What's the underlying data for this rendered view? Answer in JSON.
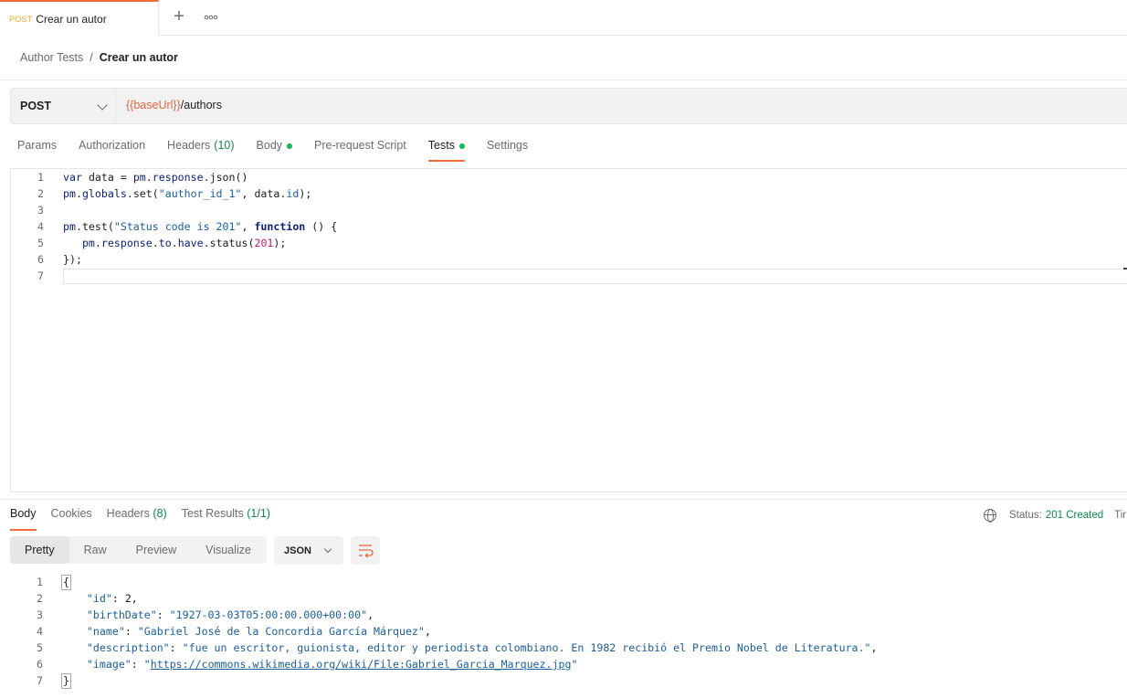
{
  "tab": {
    "method": "POST",
    "name": "Crear un autor"
  },
  "icons": {
    "add": "plus-icon",
    "more": "more-horizontal-icon",
    "globe": "globe-icon",
    "wrap": "wrap-lines-icon"
  },
  "breadcrumb": {
    "parent": "Author Tests",
    "separator": "/",
    "current": "Crear un autor"
  },
  "request": {
    "method": "POST",
    "url_variable": "{{baseUrl}}",
    "url_path": "/authors"
  },
  "request_tabs": [
    {
      "label": "Params",
      "count": ""
    },
    {
      "label": "Authorization",
      "count": ""
    },
    {
      "label": "Headers",
      "count": "(10)"
    },
    {
      "label": "Body",
      "count": ""
    },
    {
      "label": "Pre-request Script",
      "count": ""
    },
    {
      "label": "Tests",
      "count": ""
    },
    {
      "label": "Settings",
      "count": ""
    }
  ],
  "active_request_tab": "Tests",
  "test_script": {
    "line_numbers": [
      "1",
      "2",
      "3",
      "4",
      "5",
      "6",
      "7"
    ],
    "lines": [
      "var data = pm.response.json()",
      "pm.globals.set(\"author_id_1\", data.id);",
      "",
      "pm.test(\"Status code is 201\", function () {",
      "   pm.response.to.have.status(201);",
      "});",
      ""
    ]
  },
  "response_tabs": [
    {
      "label": "Body",
      "count": ""
    },
    {
      "label": "Cookies",
      "count": ""
    },
    {
      "label": "Headers",
      "count": "(8)"
    },
    {
      "label": "Test Results",
      "count": "(1/1)"
    }
  ],
  "status": {
    "label": "Status:",
    "value": "201 Created",
    "truncated": "Tir"
  },
  "view_modes": [
    "Pretty",
    "Raw",
    "Preview",
    "Visualize"
  ],
  "active_view_mode": "Pretty",
  "format": "JSON",
  "response_json": {
    "line_numbers": [
      "1",
      "2",
      "3",
      "4",
      "5",
      "6",
      "7"
    ],
    "id": "2",
    "birthDate": "1927-03-03T05:00:00.000+00:00",
    "name": "Gabriel José de la Concordia García Márquez",
    "description": "fue un escritor, guionista, editor y periodista colombiano. En 1982 recibió el Premio Nobel de Literatura.",
    "image": "https://commons.wikimedia.org/wiki/File:Gabriel_Garcia_Marquez.jpg"
  },
  "colors": {
    "accent": "#f26b3a",
    "success": "#0b8a4a",
    "dot": "#0cbb52",
    "url_var": "#e8673d"
  }
}
